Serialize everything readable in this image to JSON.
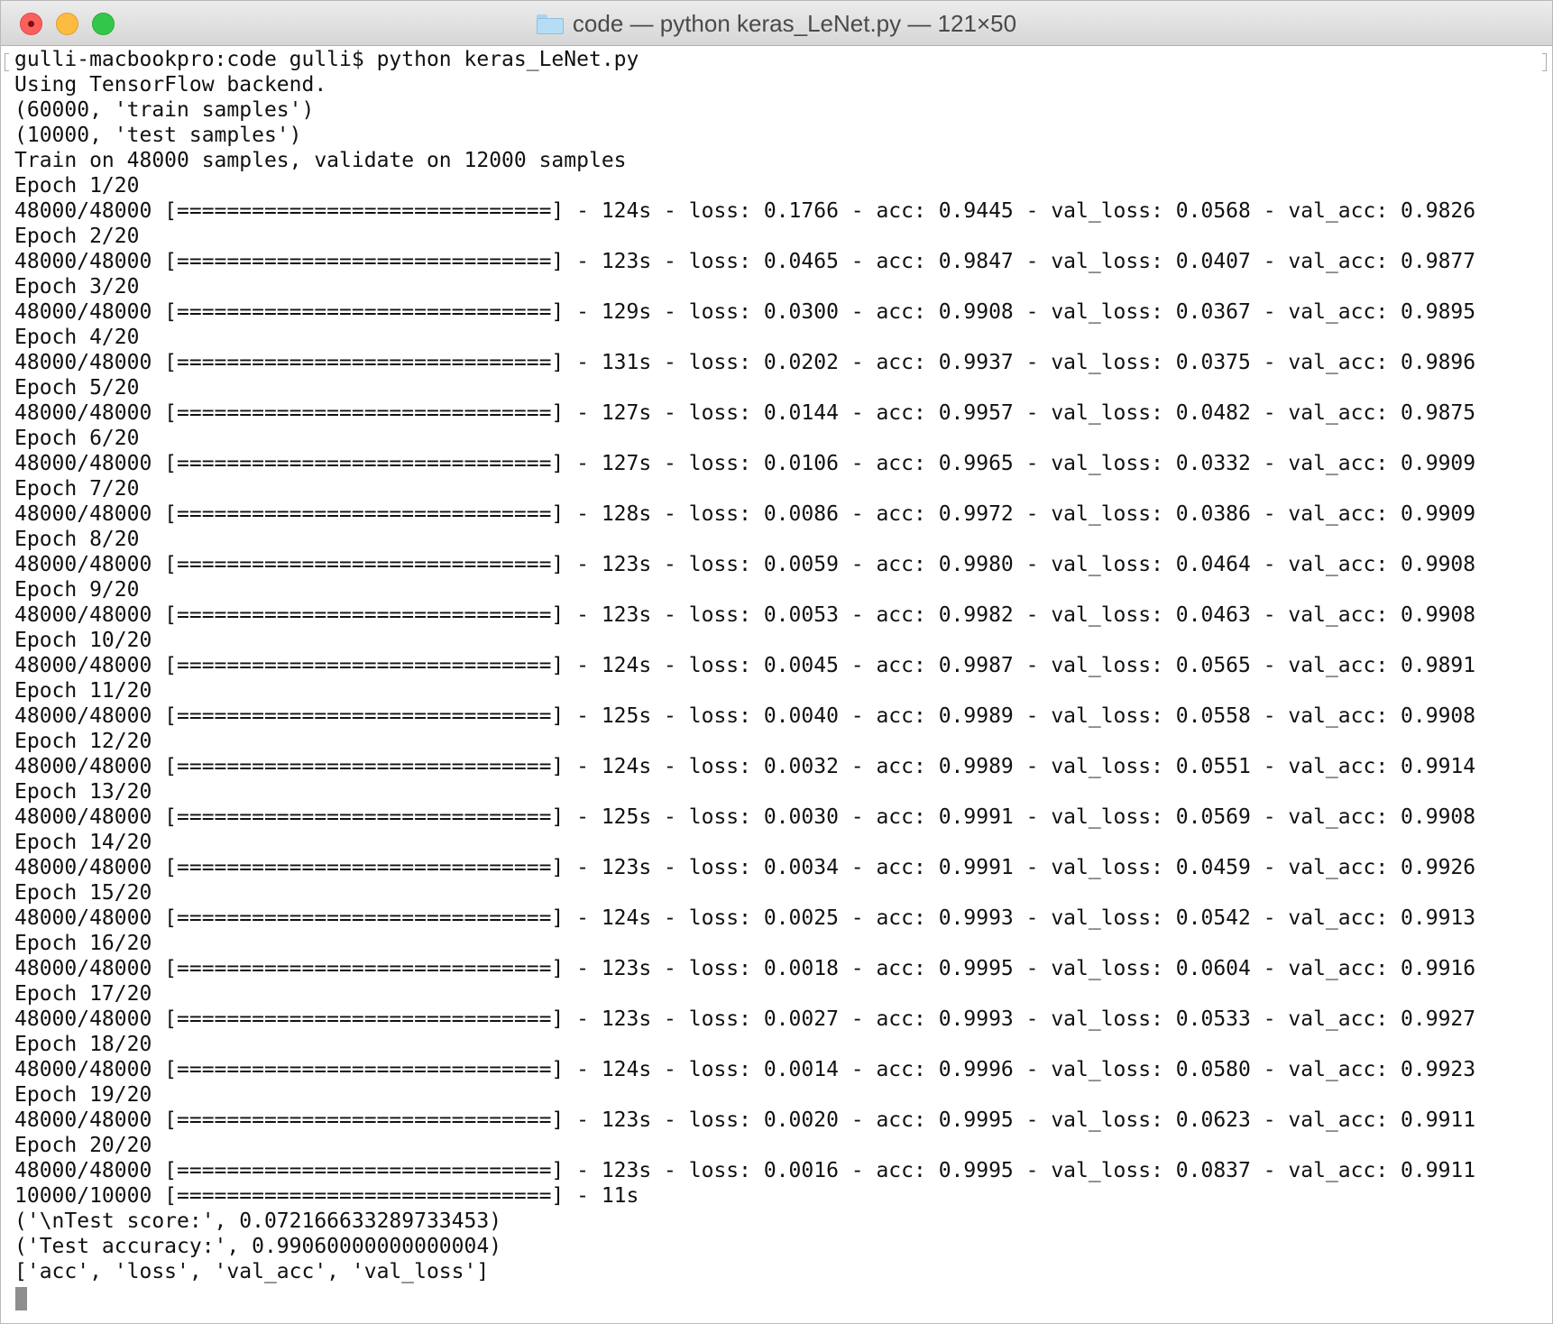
{
  "window": {
    "title": "code — python keras_LeNet.py — 121×50"
  },
  "icons": {
    "title": "folder-icon",
    "close": "close-icon",
    "minimize": "minimize-icon",
    "maximize": "maximize-icon"
  },
  "colors": {
    "close": "#fc605c",
    "minimize": "#fdbc40",
    "maximize": "#34c84a",
    "text": "#111111",
    "background": "#ffffff"
  },
  "terminal": {
    "lines": [
      "gulli-macbookpro:code gulli$ python keras_LeNet.py",
      "Using TensorFlow backend.",
      "(60000, 'train samples')",
      "(10000, 'test samples')",
      "Train on 48000 samples, validate on 12000 samples",
      "Epoch 1/20",
      "48000/48000 [==============================] - 124s - loss: 0.1766 - acc: 0.9445 - val_loss: 0.0568 - val_acc: 0.9826",
      "Epoch 2/20",
      "48000/48000 [==============================] - 123s - loss: 0.0465 - acc: 0.9847 - val_loss: 0.0407 - val_acc: 0.9877",
      "Epoch 3/20",
      "48000/48000 [==============================] - 129s - loss: 0.0300 - acc: 0.9908 - val_loss: 0.0367 - val_acc: 0.9895",
      "Epoch 4/20",
      "48000/48000 [==============================] - 131s - loss: 0.0202 - acc: 0.9937 - val_loss: 0.0375 - val_acc: 0.9896",
      "Epoch 5/20",
      "48000/48000 [==============================] - 127s - loss: 0.0144 - acc: 0.9957 - val_loss: 0.0482 - val_acc: 0.9875",
      "Epoch 6/20",
      "48000/48000 [==============================] - 127s - loss: 0.0106 - acc: 0.9965 - val_loss: 0.0332 - val_acc: 0.9909",
      "Epoch 7/20",
      "48000/48000 [==============================] - 128s - loss: 0.0086 - acc: 0.9972 - val_loss: 0.0386 - val_acc: 0.9909",
      "Epoch 8/20",
      "48000/48000 [==============================] - 123s - loss: 0.0059 - acc: 0.9980 - val_loss: 0.0464 - val_acc: 0.9908",
      "Epoch 9/20",
      "48000/48000 [==============================] - 123s - loss: 0.0053 - acc: 0.9982 - val_loss: 0.0463 - val_acc: 0.9908",
      "Epoch 10/20",
      "48000/48000 [==============================] - 124s - loss: 0.0045 - acc: 0.9987 - val_loss: 0.0565 - val_acc: 0.9891",
      "Epoch 11/20",
      "48000/48000 [==============================] - 125s - loss: 0.0040 - acc: 0.9989 - val_loss: 0.0558 - val_acc: 0.9908",
      "Epoch 12/20",
      "48000/48000 [==============================] - 124s - loss: 0.0032 - acc: 0.9989 - val_loss: 0.0551 - val_acc: 0.9914",
      "Epoch 13/20",
      "48000/48000 [==============================] - 125s - loss: 0.0030 - acc: 0.9991 - val_loss: 0.0569 - val_acc: 0.9908",
      "Epoch 14/20",
      "48000/48000 [==============================] - 123s - loss: 0.0034 - acc: 0.9991 - val_loss: 0.0459 - val_acc: 0.9926",
      "Epoch 15/20",
      "48000/48000 [==============================] - 124s - loss: 0.0025 - acc: 0.9993 - val_loss: 0.0542 - val_acc: 0.9913",
      "Epoch 16/20",
      "48000/48000 [==============================] - 123s - loss: 0.0018 - acc: 0.9995 - val_loss: 0.0604 - val_acc: 0.9916",
      "Epoch 17/20",
      "48000/48000 [==============================] - 123s - loss: 0.0027 - acc: 0.9993 - val_loss: 0.0533 - val_acc: 0.9927",
      "Epoch 18/20",
      "48000/48000 [==============================] - 124s - loss: 0.0014 - acc: 0.9996 - val_loss: 0.0580 - val_acc: 0.9923",
      "Epoch 19/20",
      "48000/48000 [==============================] - 123s - loss: 0.0020 - acc: 0.9995 - val_loss: 0.0623 - val_acc: 0.9911",
      "Epoch 20/20",
      "48000/48000 [==============================] - 123s - loss: 0.0016 - acc: 0.9995 - val_loss: 0.0837 - val_acc: 0.9911",
      "10000/10000 [==============================] - 11s",
      "('\\nTest score:', 0.072166633289733453)",
      "('Test accuracy:', 0.99060000000000004)",
      "['acc', 'loss', 'val_acc', 'val_loss']"
    ]
  }
}
